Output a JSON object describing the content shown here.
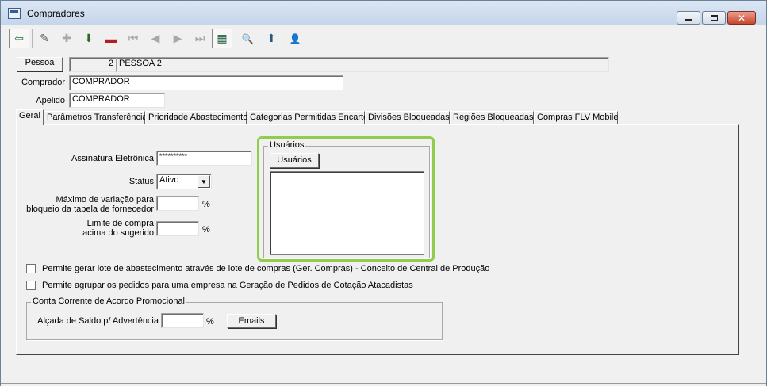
{
  "window": {
    "title": "Compradores"
  },
  "toolbar": {
    "buttons": [
      {
        "name": "exit",
        "glyph": "⇦"
      },
      {
        "name": "edit",
        "glyph": "✎"
      },
      {
        "name": "new",
        "glyph": "✚"
      },
      {
        "name": "save",
        "glyph": "⬇"
      },
      {
        "name": "delete",
        "glyph": "▬"
      },
      {
        "name": "first",
        "glyph": "⏮"
      },
      {
        "name": "previous",
        "glyph": "◀"
      },
      {
        "name": "next",
        "glyph": "▶"
      },
      {
        "name": "last",
        "glyph": "⏭"
      },
      {
        "name": "grid",
        "glyph": "▦"
      },
      {
        "name": "search",
        "glyph": "🔍"
      },
      {
        "name": "export",
        "glyph": "⬆"
      },
      {
        "name": "user",
        "glyph": "👤"
      }
    ]
  },
  "header": {
    "pessoa_button": "Pessoa",
    "pessoa_code": "2",
    "pessoa_name": "PESSOA 2",
    "comprador_label": "Comprador",
    "comprador_value": "COMPRADOR",
    "apelido_label": "Apelido",
    "apelido_value": "COMPRADOR"
  },
  "tabs": [
    "Geral",
    "Parâmetros Transferência",
    "Prioridade Abastecimento",
    "Categorias Permitidas Encarte",
    "Divisões Bloqueadas",
    "Regiões Bloqueadas",
    "Compras FLV Mobile"
  ],
  "geral": {
    "assinatura_label": "Assinatura Eletrônica",
    "assinatura_value": "**********",
    "status_label": "Status",
    "status_value": "Ativo",
    "max_variacao_label_1": "Máximo de variação para",
    "max_variacao_label_2": "bloqueio da tabela de fornecedor",
    "max_variacao_unit": "%",
    "limite_label_1": "Limite de compra",
    "limite_label_2": "acima do sugerido",
    "limite_unit": "%",
    "usuarios_group": "Usuários",
    "usuarios_button": "Usuários",
    "check_lote": "Permite gerar lote de abastecimento através de lote de compras  (Ger. Compras) - Conceito de Central de Produção",
    "check_agrupar": "Permite agrupar os pedidos para uma empresa na Geração de Pedidos de Cotação Atacadistas",
    "conta_group": "Conta Corrente de Acordo Promocional",
    "alcada_label": "Alçada de Saldo p/ Advertência",
    "alcada_unit": "%",
    "emails_button": "Emails"
  },
  "colors": {
    "highlight": "#92cc4d",
    "titlebar": "#c4d5ea",
    "close": "#c8452d"
  }
}
